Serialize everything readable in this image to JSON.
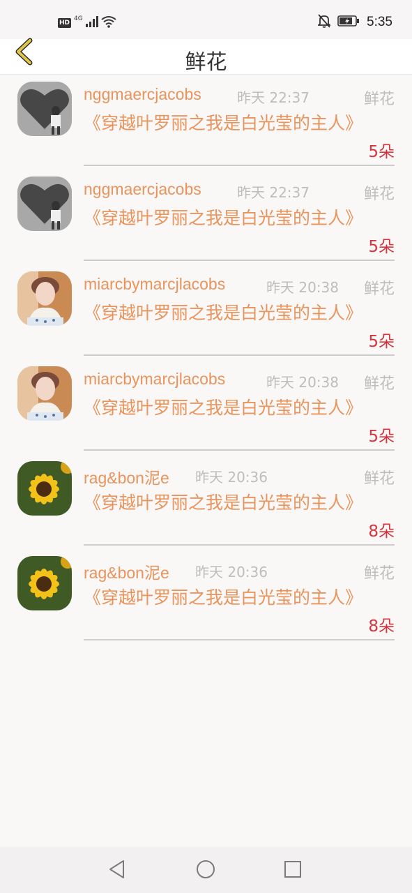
{
  "status_bar": {
    "hd": "HD",
    "network": "4G",
    "time": "5:35"
  },
  "header": {
    "title": "鲜花"
  },
  "rows": [
    {
      "name": "nggmaercjacobs",
      "time": "昨天 22:37",
      "category": "鲜花",
      "book": "《穿越叶罗丽之我是白光莹的主人》",
      "count": "5朵",
      "avatar": "heart-photo"
    },
    {
      "name": "nggmaercjacobs",
      "time": "昨天 22:37",
      "category": "鲜花",
      "book": "《穿越叶罗丽之我是白光莹的主人》",
      "count": "5朵",
      "avatar": "heart-photo"
    },
    {
      "name": "miarcbymarcjlacobs",
      "time": "昨天 20:38",
      "category": "鲜花",
      "book": "《穿越叶罗丽之我是白光莹的主人》",
      "count": "5朵",
      "avatar": "girl-photo"
    },
    {
      "name": "miarcbymarcjlacobs",
      "time": "昨天 20:38",
      "category": "鲜花",
      "book": "《穿越叶罗丽之我是白光莹的主人》",
      "count": "5朵",
      "avatar": "girl-photo"
    },
    {
      "name": "rag&bon泥e",
      "time": "昨天 20:36",
      "category": "鲜花",
      "book": "《穿越叶罗丽之我是白光莹的主人》",
      "count": "8朵",
      "avatar": "sunflower-photo"
    },
    {
      "name": "rag&bon泥e",
      "time": "昨天 20:36",
      "category": "鲜花",
      "book": "《穿越叶罗丽之我是白光莹的主人》",
      "count": "8朵",
      "avatar": "sunflower-photo"
    }
  ],
  "colors": {
    "name": "#e8945c",
    "count": "#d8343e",
    "muted": "#bdbdbd",
    "back_arrow": "#e2c64a"
  }
}
